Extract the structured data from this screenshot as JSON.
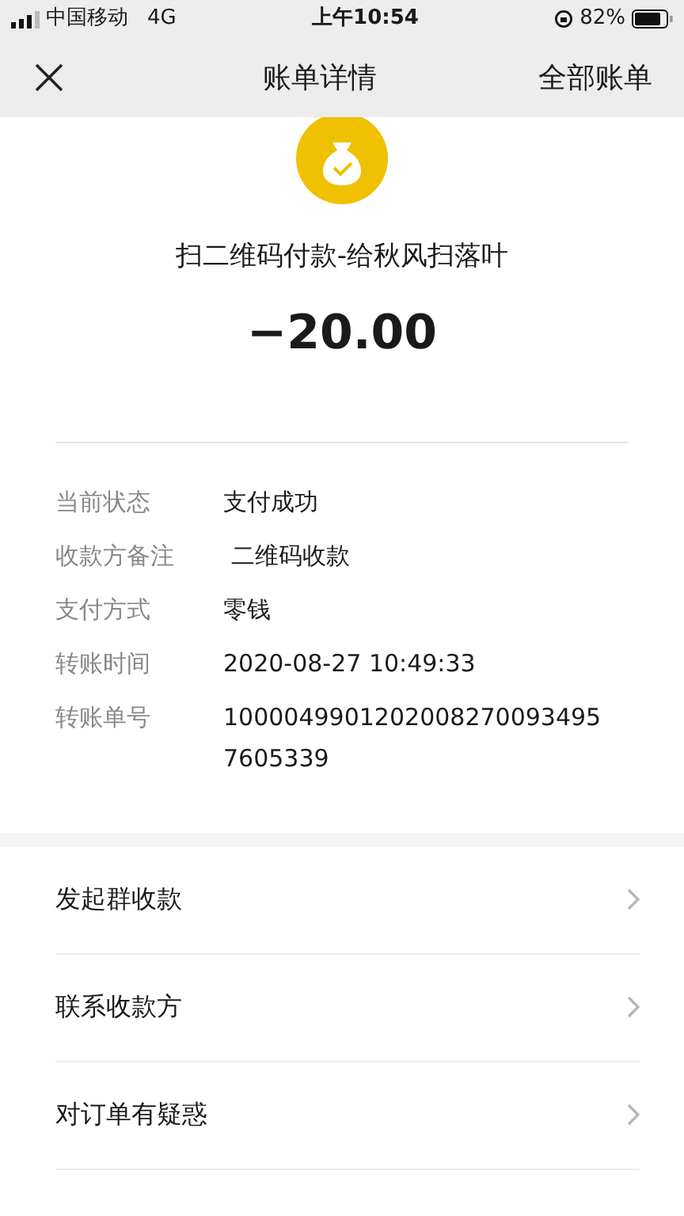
{
  "status_bar": {
    "carrier": "中国移动",
    "network": "4G",
    "time": "上午10:54",
    "battery": "82%"
  },
  "nav": {
    "title": "账单详情",
    "right": "全部账单"
  },
  "payment": {
    "title": "扫二维码付款-给秋风扫落叶",
    "amount": "−20.00"
  },
  "details": [
    {
      "label": "当前状态",
      "value": "支付成功"
    },
    {
      "label": "收款方备注",
      "value": " 二维码收款"
    },
    {
      "label": "支付方式",
      "value": "零钱"
    },
    {
      "label": "转账时间",
      "value": "2020-08-27 10:49:33"
    },
    {
      "label": "转账单号",
      "value": "10000499012020082700934957605339"
    }
  ],
  "actions": [
    {
      "label": "发起群收款"
    },
    {
      "label": "联系收款方"
    },
    {
      "label": "对订单有疑惑"
    }
  ]
}
